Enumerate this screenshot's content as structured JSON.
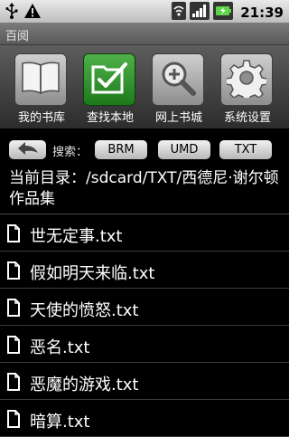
{
  "status_bar": {
    "time": "21:39",
    "icons": [
      "usb-icon",
      "warning-icon",
      "wifi-icon",
      "signal-icon",
      "battery-icon"
    ]
  },
  "title_bar": {
    "title": "百阅"
  },
  "toolbar": {
    "items": [
      {
        "label": "我的书库",
        "icon": "book-icon",
        "active": false
      },
      {
        "label": "查找本地",
        "icon": "checkbox-folder-icon",
        "active": true
      },
      {
        "label": "网上书城",
        "icon": "zoom-icon",
        "active": false
      },
      {
        "label": "系统设置",
        "icon": "gear-icon",
        "active": false
      }
    ]
  },
  "filter_bar": {
    "search_label": "搜索：",
    "buttons": [
      "BRM",
      "UMD",
      "TXT"
    ]
  },
  "current_dir": {
    "label": "当前目录：",
    "path": "/sdcard/TXT/西德尼·谢尔顿作品集"
  },
  "files": [
    "世无定事.txt",
    "假如明天来临.txt",
    "天使的愤怒.txt",
    "恶名.txt",
    "恶魔的游戏.txt",
    "暗算.txt"
  ],
  "colors": {
    "active_tile": "#2e9a2a",
    "background": "#000000"
  }
}
